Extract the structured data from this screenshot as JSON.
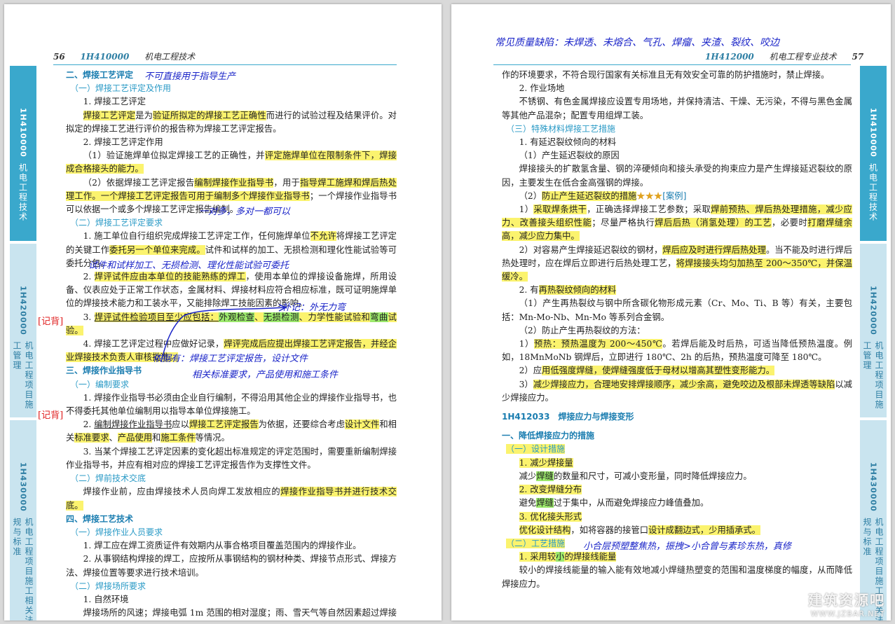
{
  "left": {
    "header": {
      "page": "56",
      "code": "1H410000",
      "title": "机电工程技术"
    },
    "tabs": [
      {
        "code": "1H410000",
        "label": "机电工程技术"
      },
      {
        "code": "1H420000",
        "label": "机电工程项目施工管理"
      },
      {
        "code": "1H430000",
        "label": "机电工程项目施工相关法规与标准"
      }
    ],
    "lines": {
      "l01": "二、焊接工艺评定",
      "l02": "（一）焊接工艺评定及作用",
      "l03": "1. 焊接工艺评定",
      "l04a": "焊接工艺评定",
      "l04b": "是为",
      "l04c": "验证所拟定的焊接工艺正确性",
      "l04d": "而进行的试验过程及结果评价。对拟定的焊接工艺进行评价的报告称为焊接工艺评定报告。",
      "l05": "2. 焊接工艺评定作用",
      "l06a": "（1）验证施焊单位拟定焊接工艺的正确性，并",
      "l06b": "评定施焊单位在限制条件下，焊接成合格接头的能力。",
      "l07a": "（2）依据焊接工艺评定报告",
      "l07b": "编制焊接作业指导书",
      "l07c": "，用于",
      "l07d": "指导焊工施焊和焊后热处理工作。一个焊接工艺评定报告可用于编制多个焊接作业指导书",
      "l07e": "；一个焊接作业指导书可以依据一个或多个焊接工艺评定报告编制。",
      "l08": "（二）焊接工艺评定要求",
      "l09a": "1. 施工单位自行组织完成焊接工艺评定工作，任何施焊单位",
      "l09b": "不允许",
      "l09c": "将焊接工艺评定的关键工作",
      "l09d": "委托另一个单位来完成。",
      "l09e": "试件和试样的加工、无损检测和理化性能试验等可委托分包。",
      "l10a": "2. ",
      "l10b": "焊评试件应由本单位的技能熟练的焊工",
      "l10c": "，使用本单位的焊接设备施焊，所用设备、仪表应处于正常工作状态，金属材料、焊接材料应符合相应标准，既可证明施焊单位的焊接技术能力和工装水平，又能排除焊工技能因素的影响。",
      "l11a": "3. ",
      "l11b": "焊评试件检验项目至少应包括：",
      "l11c": "外观检查",
      "l11d": "、",
      "l11e": "无损检测",
      "l11f": "、",
      "l11g": "力学性能试验和",
      "l11h": "弯曲",
      "l11i": "试验。",
      "l12a": "4. 焊接工艺评定过程中应做好记录，",
      "l12b": "焊评完成后应提出焊接工艺评定报告，并经企业焊接技术负责人审核批准。",
      "l13": "三、焊接作业指导书",
      "l14": "（一）编制要求",
      "l15": "1. 焊接作业指导书必须由企业自行编制，不得沿用其他企业的焊接作业指导书，也不得委托其他单位编制用以指导本单位焊接施工。",
      "l16a": "2. ",
      "l16b": "编制焊接作业指导书",
      "l16c": "应以",
      "l16d": "焊接工艺评定报告",
      "l16e": "为依据，还要综合考虑",
      "l16f": "设计文件",
      "l16g": "和相关",
      "l16h": "标准要求",
      "l16i": "、",
      "l16j": "产品使用",
      "l16k": "和",
      "l16l": "施工条件",
      "l16m": "等情况。",
      "l17": "3. 当某个焊接工艺评定因素的变化超出标准规定的评定范围时，需要重新编制焊接作业指导书，并应有相对应的焊接工艺评定报告作为支撑性文件。",
      "l18": "（二）焊前技术交底",
      "l19a": "焊接作业前，应由焊接技术人员向焊工发放相应的",
      "l19b": "焊接作业指导书并进行技术交底。",
      "l20": "四、焊接工艺技术",
      "l21": "（一）焊接作业人员要求",
      "l22": "1. 焊工应在焊工资质证件有效期内从事合格项目覆盖范围内的焊接作业。",
      "l23": "2. 从事钢结构焊接的焊工，应按所从事钢结构的钢材种类、焊接节点形式、焊接方法、焊接位置等要求进行技术培训。",
      "l24": "（二）焊接场所要求",
      "l25": "1. 自然环境",
      "l26": "焊接场所的风速；焊接电弧 1m 范围的相对湿度；雨、雪天气等自然因素超过焊接工"
    },
    "annotations": {
      "a1": "不可直接用于指导生产",
      "a2": "一对多，多对一都可以",
      "a3": "试件和试样加工、无损检测、理化性能试验可委托",
      "a4": "补记：外无力弯",
      "a5": "依据有：焊接工艺评定报告，设计文件",
      "a6": "相关标准要求，产品使用和施工条件"
    },
    "marks": {
      "m1": "[记背]",
      "m2": "[记背]"
    }
  },
  "right": {
    "header": {
      "page": "57",
      "code": "1H412000",
      "title": "机电工程专业技术"
    },
    "tabs": [
      {
        "code": "1H410000",
        "label": "机电工程技术"
      },
      {
        "code": "1H420000",
        "label": "机电工程项目施工管理"
      },
      {
        "code": "1H430000",
        "label": "机电工程项目施工相关法规与标准"
      }
    ],
    "lines": {
      "r01": "作的环境要求，不符合现行国家有关标准且无有效安全可靠的防护措施时，禁止焊接。",
      "r02": "2. 作业场地",
      "r03": "不锈钢、有色金属焊接应设置专用场地，并保持清洁、干燥、无污染，不得与黑色金属等其他产品混杂；配置专用组焊工装。",
      "r04": "（三）特殊材料焊接工艺措施",
      "r05": "1. 有延迟裂纹倾向的材料",
      "r06": "（1）产生延迟裂纹的原因",
      "r07": "焊接接头的扩散氢含量、钢的淬硬倾向和接头承受的拘束应力是产生焊接延迟裂纹的原因，主要发生在低合金高强钢的焊接。",
      "r08a": "（2）",
      "r08b": "防止产生延迟裂纹的措施",
      "r08c": "★★★",
      "r08d": "[案例]",
      "r09a": "1）",
      "r09b": "采取焊条烘干",
      "r09c": "，正确选择焊接工艺参数；采取",
      "r09d": "焊前预热、焊后热处理措施，减少应力、改善接头组织性能",
      "r09e": "；尽量严格执行",
      "r09f": "焊后后热（消氢处理）的工艺",
      "r09g": "，必要时",
      "r09h": "打磨焊缝余高，减少应力集中。",
      "r10a": "2）对容易产生焊接延迟裂纹的钢材，",
      "r10b": "焊后应及时进行焊后热处理",
      "r10c": "。当不能及时进行焊后热处理时，应在焊后立即进行后热处理工艺，",
      "r10d": "将焊接接头均匀加热至 200～350℃，并保温缓冷。",
      "r11a": "2. 有",
      "r11b": "再热裂纹倾向的材料",
      "r12": "（1）产生再热裂纹与钢中所含碳化物形成元素（Cr、Mo、Ti、B 等）有关，主要包括：Mn-Mo-Nb、Mn-Mo 等系列合金钢。",
      "r13": "（2）防止产生再热裂纹的方法：",
      "r14a": "1）",
      "r14b": "预热：预热温度为 200～450℃",
      "r14c": "。若焊后能及时后热，可适当降低预热温度。例如，18MnMoNb 钢焊后，立即进行 180℃、2h 的后热，预热温度可降至 180℃。",
      "r15a": "2）应",
      "r15b": "用低强度焊缝，使焊缝强度低于母材以增高其塑性变形能力。",
      "r16a": "3）",
      "r16b": "减少焊接应力，合理地安排焊接顺序，减少余高，避免咬边及根部未焊透等缺陷",
      "r16c": "以减少焊接应力。",
      "r17": "1H412033　焊接应力与焊接变形",
      "r18": "一、降低焊接应力的措施",
      "r19": "（一）设计措施",
      "r20": "1. 减少焊接量",
      "r21a": "减少",
      "r21b": "焊缝",
      "r21c": "的数量和尺寸，可减小变形量，同时降低焊接应力。",
      "r22": "2. 改变焊缝分布",
      "r23a": "避免",
      "r23b": "焊缝",
      "r23c": "过于集中，从而避免焊接应力峰值叠加。",
      "r24": "3. 优化接头形式",
      "r25a": "优化设计结构",
      "r25b": "，如将容器的接管口",
      "r25c": "设计成翻边式，少用插承式。",
      "r26": "（二）工艺措施",
      "r27a": "1. 采用较",
      "r27b": "小",
      "r27c": "的焊接线能量",
      "r28": "较小的焊接线能量的输入能有效地减小焊缝热塑变的范围和温度梯度的幅度，从而降低焊接应力。"
    },
    "annotations": {
      "b1": "常见质量缺陷：未焊透、未熔合、气孔、焊瘤、夹渣、裂纹、咬边",
      "b2": "小合层预塑整焦热，振拽>小合曾与素珍东热，真修"
    }
  },
  "watermark": {
    "cn": "建筑资源吧",
    "en": "WWW.JZBAR.NET"
  }
}
